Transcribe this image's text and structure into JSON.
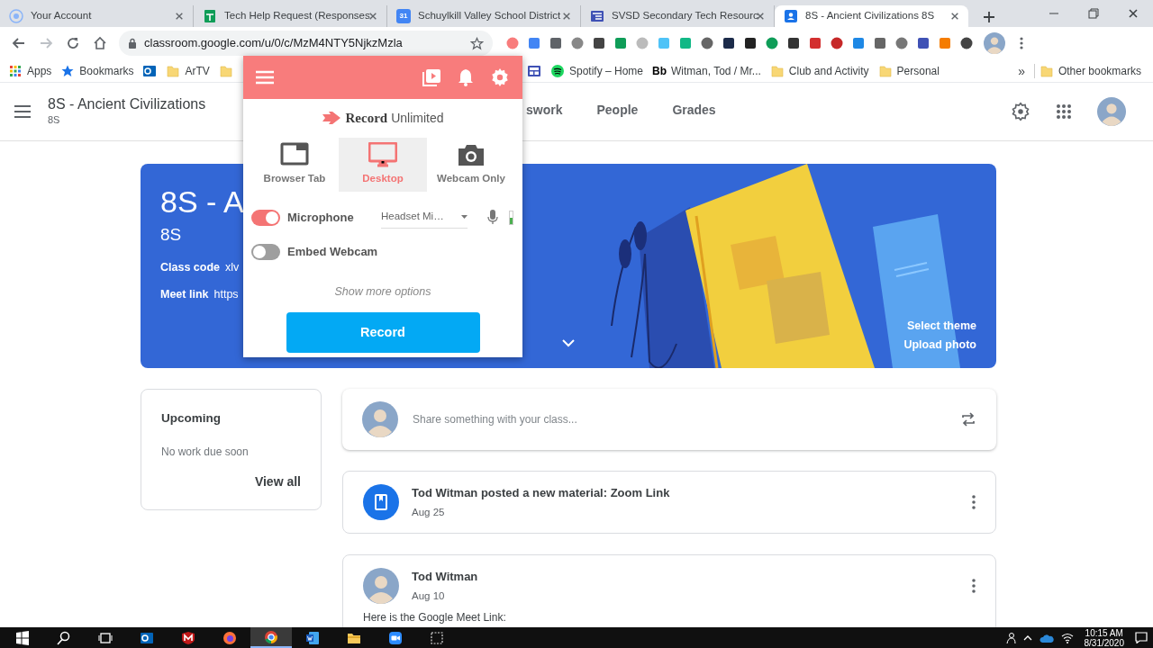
{
  "browser": {
    "tabs": [
      {
        "kind": "account",
        "title": "Your Account",
        "selected": false
      },
      {
        "kind": "sheets",
        "title": "Tech Help Request (Responses",
        "selected": false
      },
      {
        "kind": "calendar",
        "icon_text": "31",
        "title": "Schuylkill Valley School District",
        "selected": false
      },
      {
        "kind": "sites",
        "title": "SVSD Secondary Tech Resourc",
        "selected": false
      },
      {
        "kind": "classroom",
        "title": "8S - Ancient Civilizations 8S",
        "selected": true
      }
    ],
    "address": "classroom.google.com/u/0/c/MzM4NTY5NjkzMzla",
    "bookmark_groups": [
      [
        {
          "kind": "apps",
          "label": "Apps"
        },
        {
          "kind": "star",
          "label": "Bookmarks"
        },
        {
          "kind": "outlook"
        },
        {
          "kind": "folder",
          "label": "ArTV"
        },
        {
          "kind": "folder"
        }
      ],
      [
        {
          "kind": "layout"
        },
        {
          "kind": "spotify",
          "label": "Spotify – Home"
        },
        {
          "kind": "text",
          "icon_text": "Bb",
          "label": "Witman, Tod / Mr..."
        },
        {
          "kind": "folder",
          "label": "Club and Activity"
        },
        {
          "kind": "folder",
          "label": "Personal"
        }
      ]
    ],
    "bookmarks_overflow": "»",
    "other_bookmarks": "Other bookmarks"
  },
  "classroom": {
    "title": "8S - Ancient Civilizations",
    "section": "8S",
    "nav": [
      {
        "label": "swork",
        "selected": false
      },
      {
        "label": "People",
        "selected": false
      },
      {
        "label": "Grades",
        "selected": false
      }
    ],
    "banner": {
      "title": "8S - A",
      "section": "8S",
      "details": [
        {
          "label": "Class code",
          "value": "xlv"
        },
        {
          "label": "Meet link",
          "value": "https"
        }
      ],
      "actions": [
        "Select theme",
        "Upload photo"
      ]
    },
    "upcoming": {
      "title": "Upcoming",
      "message": "No work due soon",
      "link": "View all"
    },
    "share": {
      "placeholder": "Share something with your class..."
    },
    "posts": [
      {
        "kind": "material",
        "headline": "Tod Witman posted a new material: Zoom Link",
        "date": "Aug 25"
      },
      {
        "kind": "announcement",
        "headline": "Tod Witman",
        "date": "Aug 10",
        "body": "Here is the Google Meet Link:"
      }
    ]
  },
  "recorder": {
    "brand": [
      "Record",
      "Unlimited"
    ],
    "modes": [
      {
        "kind": "tab",
        "label": "Browser Tab",
        "selected": false
      },
      {
        "kind": "desktop",
        "label": "Desktop",
        "selected": true
      },
      {
        "kind": "webcam",
        "label": "Webcam Only",
        "selected": false
      }
    ],
    "options": [
      {
        "kind": "mic",
        "label": "Microphone",
        "on": true,
        "device": "Headset Mi…",
        "level": 0.5
      },
      {
        "kind": "plain",
        "label": "Embed Webcam",
        "on": false
      }
    ],
    "more": "Show more options",
    "record": "Record"
  },
  "taskbar": {
    "apps": [
      {
        "kind": "outlook",
        "selected": false
      },
      {
        "kind": "shield",
        "selected": false
      },
      {
        "kind": "firefox",
        "selected": false
      },
      {
        "kind": "chrome",
        "selected": true
      },
      {
        "kind": "word",
        "selected": false
      },
      {
        "kind": "explorer",
        "selected": false
      },
      {
        "kind": "zoom",
        "selected": false
      },
      {
        "kind": "snip",
        "selected": false
      }
    ],
    "time": "10:15 AM",
    "date": "8/31/2020"
  }
}
